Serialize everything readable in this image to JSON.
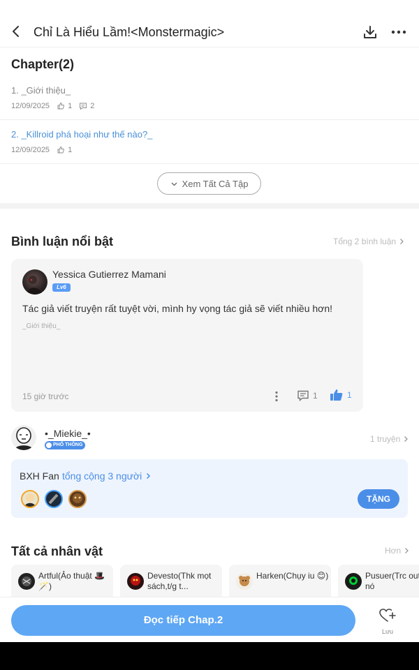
{
  "header": {
    "title": "Chỉ Là Hiểu Lầm!<Monstermagic>",
    "back_icon": "back-chevron-icon",
    "download_icon": "download-icon",
    "more_icon": "more-icon"
  },
  "chapters": {
    "title": "Chapter(2)",
    "items": [
      {
        "name": "1. _Giới thiệu_",
        "date": "12/09/2025",
        "likes": "1",
        "comments": "2",
        "color": "#888888"
      },
      {
        "name": "2. _Killroid phá hoại như thế nào?_",
        "date": "12/09/2025",
        "likes": "1",
        "color": "#4a90d9"
      }
    ],
    "view_all_label": "Xem Tất Cả Tập"
  },
  "comments": {
    "title": "Bình luận nổi bật",
    "total_label": "Tổng 2 bình luận",
    "featured": {
      "user_name": "Yessica Gutierrez Mamani",
      "level": "Lv6",
      "text": "Tác giả viết truyện rất tuyệt vời, mình hy vọng tác giả sẽ viết nhiều hơn!",
      "chapter_ref": "_Giới thiệu_",
      "time": "15 giờ trước",
      "comment_count": "1",
      "like_count": "1"
    }
  },
  "author": {
    "name": "•_Miekie_•",
    "badge": "PHỔ THÔNG",
    "stories_label": "1 truyện"
  },
  "fans": {
    "label": "BXH Fan",
    "total_label": "tổng cộng 3 người",
    "gift_label": "TẶNG"
  },
  "characters": {
    "title": "Tất cả nhân vật",
    "more_label": "Hơn",
    "items": [
      {
        "name": "Artful(Ảo thuật 🎩🪄)"
      },
      {
        "name": "Devesto(Thk mọt sách,t/g t..."
      },
      {
        "name": "Harken(Chụy iu 😊)"
      },
      {
        "name": "Pusuer(Trc out này nó"
      }
    ]
  },
  "bottom_bar": {
    "read_label": "Đọc tiếp Chap.2",
    "save_label": "Lưu"
  },
  "colors": {
    "accent": "#5ea7f4",
    "link_blue": "#4a90d9",
    "fan_box_bg": "#eef4fd"
  }
}
